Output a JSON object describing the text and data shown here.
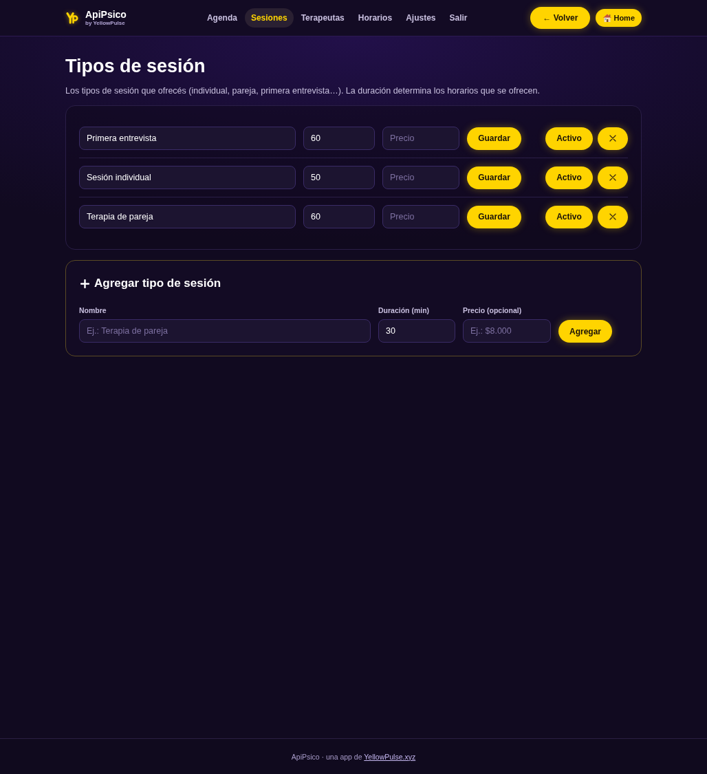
{
  "header": {
    "brand": {
      "title": "ApiPsico",
      "subtitle": "by YellowPulse"
    },
    "nav": [
      {
        "label": "Agenda",
        "selected": false
      },
      {
        "label": "Sesiones",
        "selected": true
      },
      {
        "label": "Terapeutas",
        "selected": false
      },
      {
        "label": "Horarios",
        "selected": false
      },
      {
        "label": "Ajustes",
        "selected": false
      },
      {
        "label": "Salir",
        "selected": false
      }
    ],
    "actions": [
      {
        "kind": "back",
        "label": "← Volver"
      },
      {
        "kind": "home",
        "label": "Home"
      }
    ]
  },
  "page": {
    "title": "Tipos de sesión",
    "description": "Los tipos de sesión que ofrecés (individual, pareja, primera entrevista…). La duración determina los horarios que se ofrecen."
  },
  "session_types": [
    {
      "name": "Primera entrevista",
      "duration": "60",
      "price_placeholder": "Precio",
      "save_label": "Guardar",
      "status_label": "Activo",
      "active": true
    },
    {
      "name": "Sesión individual",
      "duration": "50",
      "price_placeholder": "Precio",
      "save_label": "Guardar",
      "status_label": "Activo",
      "active": true
    },
    {
      "name": "Terapia de pareja",
      "duration": "60",
      "price_placeholder": "Precio",
      "save_label": "Guardar",
      "status_label": "Activo",
      "active": true
    }
  ],
  "new_type": {
    "title": "Agregar tipo de sesión",
    "fields": [
      {
        "kind": "name",
        "label": "Nombre",
        "placeholder": "Ej.: Terapia de pareja"
      },
      {
        "kind": "duration",
        "label": "Duración (min)",
        "value": "30"
      },
      {
        "kind": "price",
        "label": "Precio (opcional)",
        "placeholder": "Ej.: $8.000"
      }
    ],
    "submit": "Agregar"
  },
  "footer": {
    "text": "ApiPsico · una app de",
    "link": "YellowPulse.xyz"
  }
}
